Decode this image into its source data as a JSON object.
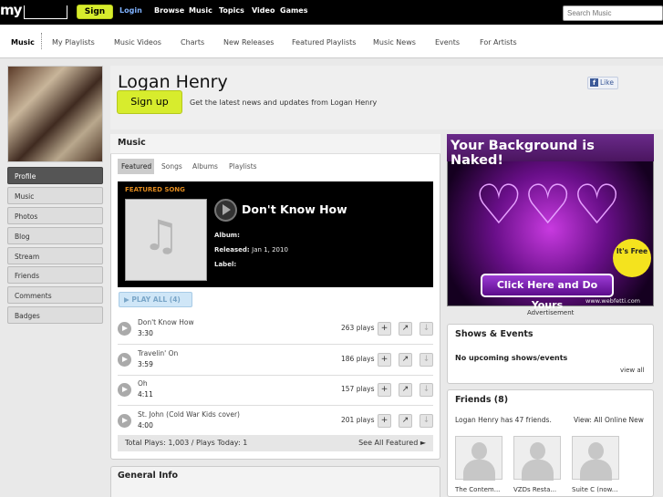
{
  "topbar": {
    "logo": "my",
    "signup": "Sign up",
    "login": "Login",
    "nav": [
      "Browse",
      "Music",
      "Topics",
      "Video",
      "Games"
    ],
    "search_placeholder": "Search Music"
  },
  "subnav": [
    "Music",
    "My Playlists",
    "Music Videos",
    "Charts",
    "New Releases",
    "Featured Playlists",
    "Music News",
    "Events",
    "For Artists"
  ],
  "sidebar": [
    "Profile",
    "Music",
    "Photos",
    "Blog",
    "Stream",
    "Friends",
    "Comments",
    "Badges"
  ],
  "profile": {
    "name": "Logan Henry",
    "fb_like": "Like",
    "signup": "Sign up",
    "signup_desc": "Get the latest news and updates from Logan Henry"
  },
  "music": {
    "title": "Music",
    "tabs": [
      "Featured",
      "Songs",
      "Albums",
      "Playlists"
    ],
    "featured_label": "FEATURED SONG",
    "featured_song": "Don't Know How",
    "album_label": "Album:",
    "released_label": "Released:",
    "released_value": "Jan 1, 2010",
    "label_label": "Label:",
    "play_all": "PLAY ALL (4)",
    "songs": [
      {
        "name": "Don't Know How",
        "time": "3:30",
        "plays": "263 plays"
      },
      {
        "name": "Travelin' On",
        "time": "3:59",
        "plays": "186 plays"
      },
      {
        "name": "Oh",
        "time": "4:11",
        "plays": "157 plays"
      },
      {
        "name": "St. John (Cold War Kids cover)",
        "time": "4:00",
        "plays": "201 plays"
      }
    ],
    "totals": "Total Plays: 1,003 / Plays Today: 1",
    "see_all": "See All Featured ►"
  },
  "general_info": {
    "title": "General Info"
  },
  "ad": {
    "headline": "Your Background is Naked!",
    "burst": "It's Free",
    "cta": "Click Here and Do Yours",
    "url": "www.webfetti.com",
    "caption": "Advertisement"
  },
  "shows": {
    "title": "Shows & Events",
    "empty": "No upcoming shows/events",
    "view_all": "view all"
  },
  "friends": {
    "title": "Friends (8)",
    "count_text": "Logan Henry has 47 friends.",
    "view_text": "View:  All  Online  New",
    "list": [
      "The Contem...",
      "VZDs Resta...",
      "Suite C (now..."
    ]
  },
  "colors": {
    "signup": "#d7ec2d",
    "topbar": "#000000",
    "featured_label": "#e08a1e",
    "facebook": "#3b5998"
  }
}
